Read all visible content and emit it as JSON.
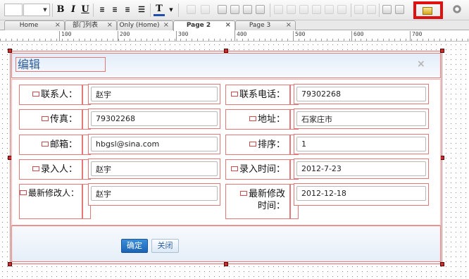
{
  "toolbar": {
    "bold": "B",
    "italic": "I",
    "underline": "U",
    "font_color": "T",
    "highlight_color": "#e01010"
  },
  "tabs": [
    {
      "label": "Home",
      "close": "×"
    },
    {
      "label": "部门列表",
      "close": "×"
    },
    {
      "label": "Only (Home)",
      "close": "×"
    },
    {
      "label": "Page 2",
      "close": "×"
    },
    {
      "label": "Page 3",
      "close": "×"
    }
  ],
  "ruler": {
    "marks": [
      "100",
      "200",
      "300",
      "400",
      "500",
      "600",
      "700"
    ]
  },
  "dialog": {
    "title": "编辑",
    "close": "×",
    "fields": {
      "contact": {
        "label": "联系人：",
        "value": "赵宇"
      },
      "phone": {
        "label": "联系电话：",
        "value": "79302268"
      },
      "fax": {
        "label": "传真：",
        "value": "79302268"
      },
      "address": {
        "label": "地址：",
        "value": "石家庄市"
      },
      "email": {
        "label": "邮箱：",
        "value": "hbgsl@sina.com"
      },
      "order": {
        "label": "排序：",
        "value": "1"
      },
      "creator": {
        "label": "录入人：",
        "value": "赵宇"
      },
      "create_time": {
        "label": "录入时间：",
        "value": "2012-7-23"
      },
      "modifier": {
        "label": "最新修改人：",
        "value": "赵宇"
      },
      "modify_time": {
        "label_1": "最新修改",
        "label_2": "时间：",
        "value": "2012-12-18"
      }
    },
    "buttons": {
      "ok": "确定",
      "close": "关闭"
    }
  },
  "colors": {
    "accent": "#1b64b5",
    "selection": "#e47777",
    "title_text": "#2f5d97"
  }
}
